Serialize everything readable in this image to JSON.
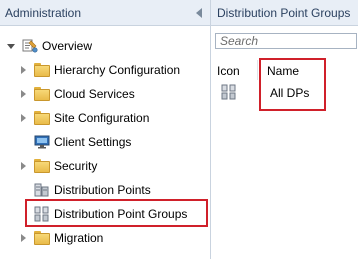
{
  "left_pane": {
    "header_title": "Administration",
    "tree": [
      {
        "label": "Overview",
        "expander": "down",
        "icon": "overview-icon"
      },
      {
        "label": "Hierarchy Configuration",
        "expander": "right",
        "icon": "folder-icon"
      },
      {
        "label": "Cloud Services",
        "expander": "right",
        "icon": "folder-icon"
      },
      {
        "label": "Site Configuration",
        "expander": "right",
        "icon": "folder-icon"
      },
      {
        "label": "Client Settings",
        "expander": "none",
        "icon": "monitor-icon"
      },
      {
        "label": "Security",
        "expander": "right",
        "icon": "folder-icon"
      },
      {
        "label": "Distribution Points",
        "expander": "none",
        "icon": "server-icon"
      },
      {
        "label": "Distribution Point Groups",
        "expander": "none",
        "icon": "server-group-icon",
        "highlighted": true
      },
      {
        "label": "Migration",
        "expander": "right",
        "icon": "folder-icon"
      }
    ]
  },
  "right_pane": {
    "header_title": "Distribution Point Groups",
    "search": {
      "placeholder": "Search",
      "value": ""
    },
    "columns": [
      "Icon",
      "Name"
    ],
    "rows": [
      {
        "icon": "server-group-icon",
        "name": "All DPs"
      }
    ]
  },
  "colors": {
    "header_bg": "#e8eef6",
    "header_text": "#2b4160",
    "highlight_border": "#d0202a",
    "folder": "#f7d878"
  }
}
